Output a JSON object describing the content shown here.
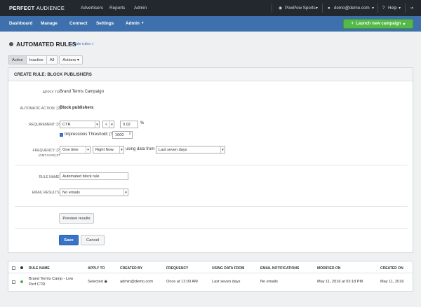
{
  "topbar": {
    "logo_bold": "PERFECT",
    "logo_light": "AUDIENCE",
    "nav": [
      "Advertisers",
      "Reports",
      "Admin"
    ],
    "account": "PowPow Sports",
    "user": "demo@demo.com",
    "help": "Help"
  },
  "navbar": {
    "items": [
      "Dashboard",
      "Manage",
      "Connect",
      "Settings",
      "Admin"
    ],
    "launch_label": "Launch new campaign"
  },
  "page": {
    "title": "AUTOMATED RULES",
    "create_link": "Create rules »"
  },
  "filters": {
    "active": "Active",
    "inactive": "Inactive",
    "all": "All",
    "actions": "Actions"
  },
  "form": {
    "header": "CREATE RULE: BLOCK PUBLISHERS",
    "apply_to_label": "APPLY TO:",
    "apply_to_value": "Brand Terms Campaign",
    "action_label": "AUTOMATIC ACTION:",
    "action_help": "[?]",
    "action_value": "Block publishers",
    "requirement_label": "REQUIREMENT:",
    "requirement_help": "[?]",
    "metric": "CTR",
    "operator": "<",
    "threshold_value": "0.02",
    "percent": "%",
    "impressions_label": "Impressions Threshold:",
    "impressions_help": "[?]",
    "impressions_value": "1000",
    "frequency_label": "FREQUENCY:",
    "frequency_help": "[?]",
    "timezone": "(GMT-04:00) ET",
    "frequency_value": "One time",
    "timing_value": "Right Now",
    "using_data_from": "using data from",
    "data_range": "Last seven days",
    "rule_name_label": "RULE NAME:",
    "rule_name_value": "Automated block rule",
    "email_label": "EMAIL RESULTS:",
    "email_value": "No emails",
    "preview_label": "Preview results",
    "save_label": "Save",
    "cancel_label": "Cancel"
  },
  "table": {
    "headers": [
      "RULE NAME",
      "APPLY TO",
      "CREATED BY",
      "FREQUENCY",
      "USING DATA FROM",
      "EMAIL NOTIFICATIONS",
      "MODIFIED ON",
      "CREATED ON"
    ],
    "rows": [
      {
        "name_line1": "Brand Terms Camp - Low",
        "name_line2": "Perf CTR",
        "apply_to": "Selected",
        "created_by": "admin@demo.com",
        "frequency": "Once at 12:00 AM",
        "data_from": "Last seven days",
        "email": "No emails",
        "modified_on": "May 11, 2016 at 03:18 PM",
        "created_on": "May 11, 2016"
      }
    ]
  },
  "colors": {
    "topbar": "#23272e",
    "navbar": "#3d70ac",
    "launch": "#54b948",
    "save": "#3a74c8"
  }
}
